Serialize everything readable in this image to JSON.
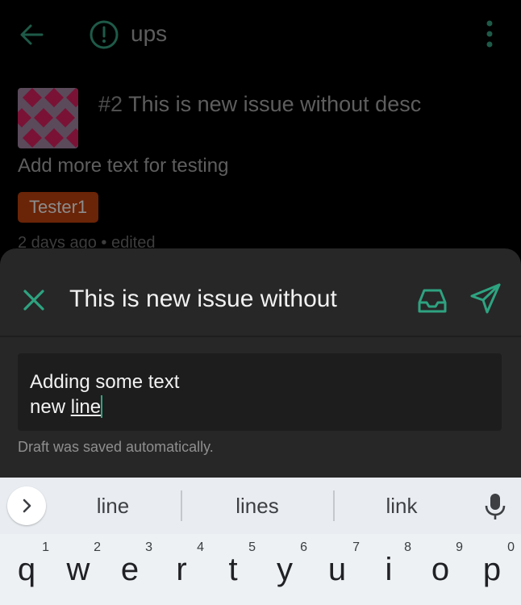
{
  "background": {
    "repo_name": "ups",
    "issue_number": "#2",
    "issue_title": "This is new issue without desc",
    "issue_description": "Add more text for testing",
    "label": "Tester1",
    "meta": "2 days ago  •  edited"
  },
  "sheet": {
    "title": "This is new issue without",
    "editor_line1": "Adding some text",
    "editor_line2_prefix": "new ",
    "editor_line2_word": "line",
    "draft_note": "Draft was saved automatically."
  },
  "keyboard": {
    "suggestions": [
      "line",
      "lines",
      "link"
    ],
    "keys": [
      {
        "letter": "q",
        "digit": "1"
      },
      {
        "letter": "w",
        "digit": "2"
      },
      {
        "letter": "e",
        "digit": "3"
      },
      {
        "letter": "r",
        "digit": "4"
      },
      {
        "letter": "t",
        "digit": "5"
      },
      {
        "letter": "y",
        "digit": "6"
      },
      {
        "letter": "u",
        "digit": "7"
      },
      {
        "letter": "i",
        "digit": "8"
      },
      {
        "letter": "o",
        "digit": "9"
      },
      {
        "letter": "p",
        "digit": "0"
      }
    ]
  },
  "colors": {
    "accent": "#2ea380",
    "label_bg": "#6a2407",
    "sheet_bg": "#272727"
  },
  "icons": {
    "back": "arrow-left-icon",
    "issue": "alert-circle-icon",
    "more": "more-vertical-icon",
    "close": "close-icon",
    "save": "inbox-icon",
    "send": "send-icon",
    "expand": "chevron-right-icon",
    "voice": "mic-icon"
  }
}
